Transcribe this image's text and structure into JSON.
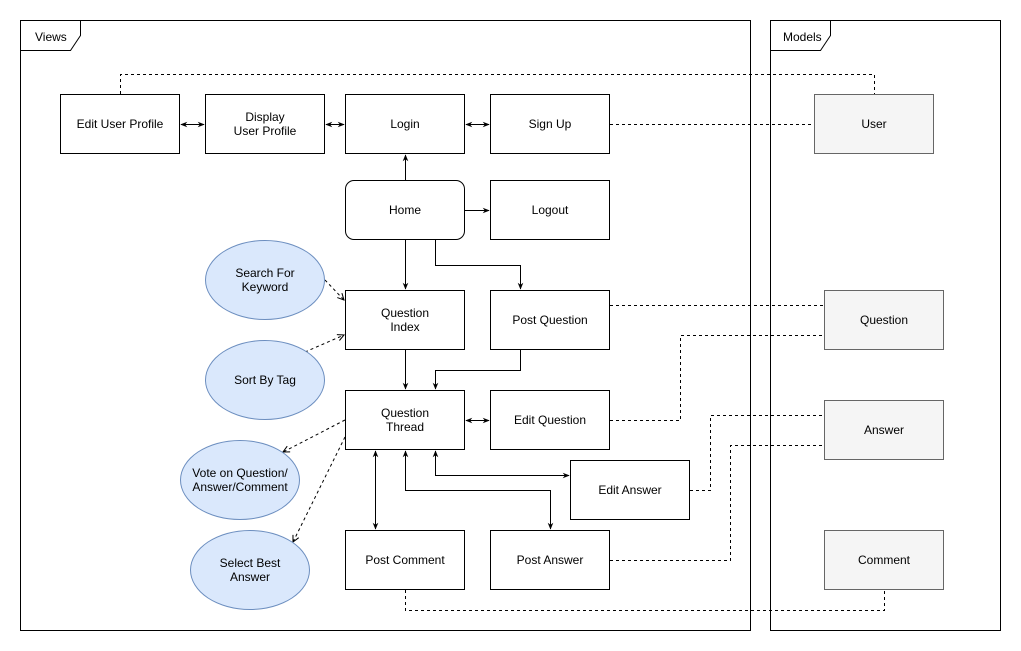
{
  "frames": {
    "views": "Views",
    "models": "Models"
  },
  "views": {
    "edit_user_profile": "Edit User Profile",
    "display_user_profile": "Display\nUser Profile",
    "login": "Login",
    "sign_up": "Sign Up",
    "home": "Home",
    "logout": "Logout",
    "question_index": "Question\nIndex",
    "post_question": "Post Question",
    "question_thread": "Question\nThread",
    "edit_question": "Edit Question",
    "edit_answer": "Edit Answer",
    "post_comment": "Post Comment",
    "post_answer": "Post Answer"
  },
  "actions": {
    "search_keyword": "Search For\nKeyword",
    "sort_by_tag": "Sort By Tag",
    "vote": "Vote on Question/\nAnswer/Comment",
    "select_best": "Select Best\nAnswer"
  },
  "models": {
    "user": "User",
    "question": "Question",
    "answer": "Answer",
    "comment": "Comment"
  },
  "colors": {
    "model_fill": "#f5f5f5",
    "model_stroke": "#666666",
    "action_fill": "#dae8fc",
    "action_stroke": "#6c8ebf"
  }
}
